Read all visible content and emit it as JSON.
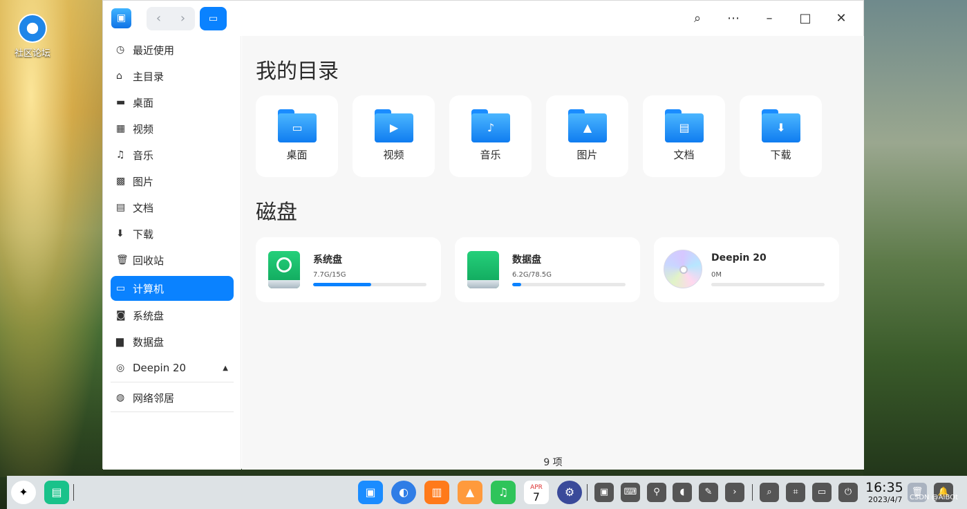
{
  "desktop": {
    "icon_label": "社区论坛"
  },
  "titlebar": {
    "nav_back": "‹",
    "nav_forward": "›"
  },
  "sidebar": {
    "items": [
      {
        "label": "最近使用",
        "icon": "clock-icon"
      },
      {
        "label": "主目录",
        "icon": "home-icon"
      },
      {
        "label": "桌面",
        "icon": "desktop-icon"
      },
      {
        "label": "视频",
        "icon": "video-icon"
      },
      {
        "label": "音乐",
        "icon": "music-icon"
      },
      {
        "label": "图片",
        "icon": "picture-icon"
      },
      {
        "label": "文档",
        "icon": "document-icon"
      },
      {
        "label": "下载",
        "icon": "download-icon"
      },
      {
        "label": "回收站",
        "icon": "trash-icon"
      },
      {
        "label": "计算机",
        "icon": "computer-icon",
        "active": true
      },
      {
        "label": "系统盘",
        "icon": "system-disk-icon"
      },
      {
        "label": "数据盘",
        "icon": "data-disk-icon"
      },
      {
        "label": "Deepin 20",
        "icon": "disc-icon"
      },
      {
        "label": "网络邻居",
        "icon": "network-icon"
      }
    ]
  },
  "main": {
    "dir_title": "我的目录",
    "directories": [
      "桌面",
      "视频",
      "音乐",
      "图片",
      "文档",
      "下载"
    ],
    "disk_title": "磁盘",
    "disks": [
      {
        "name": "系统盘",
        "usage": "7.7G/15G",
        "fill": 0.51
      },
      {
        "name": "数据盘",
        "usage": "6.2G/78.5G",
        "fill": 0.08
      },
      {
        "name": "Deepin 20",
        "usage": "0M",
        "fill": 0
      }
    ],
    "status": "9 项"
  },
  "taskbar": {
    "time": "16:35",
    "date": "2023/4/7",
    "calendar_month": "APR",
    "calendar_day": "7",
    "watermark": "CSDN @AIBOt"
  },
  "colors": {
    "accent": "#0a82ff",
    "disk_green": "#0ea35a"
  }
}
